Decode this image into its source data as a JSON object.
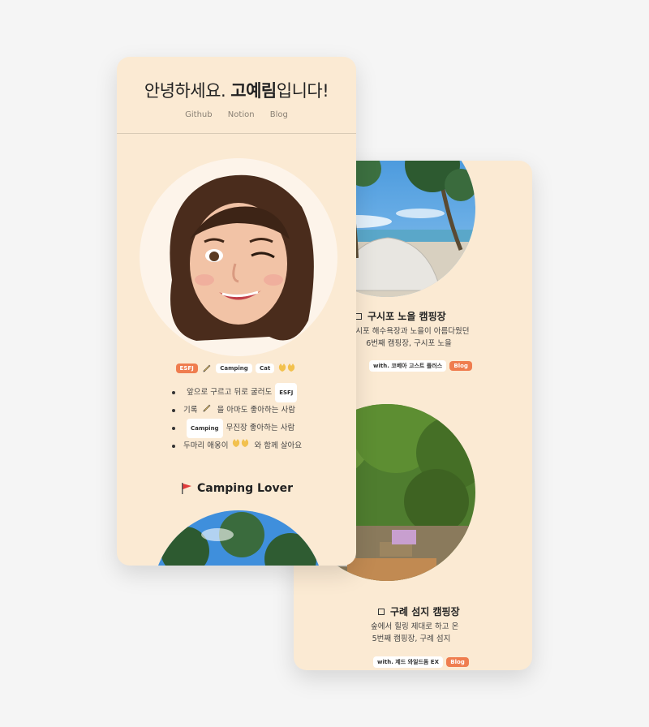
{
  "profile": {
    "greeting_prefix": "안녕하세요. ",
    "name": "고예림",
    "greeting_suffix": "입니다!",
    "nav": [
      "Github",
      "Notion",
      "Blog"
    ],
    "badges": {
      "mbti": "ESFJ",
      "camping": "Camping",
      "cat": "Cat"
    },
    "bio": [
      {
        "text": "앞으로 구르고 뒤로 굴러도",
        "tag": "ESFJ"
      },
      {
        "text_before": "기록",
        "text_after": "을 아마도 좋아하는 사람"
      },
      {
        "tag": "Camping",
        "text": "무진장 좋아하는 사람"
      },
      {
        "text_before": "두마리 애옹이",
        "text_after": "와 함께 살아요"
      }
    ],
    "section_title": "Camping Lover"
  },
  "camps": [
    {
      "title": "구시포 노을 캠핑장",
      "desc_line1": "구시포 해수욕장과 노을이 아름다웠던",
      "desc_line2": "6번째 캠핑장, 구시포 노을",
      "with": "with. 코베아 고스트 플러스",
      "link": "Blog"
    },
    {
      "title": "구례 섬지 캠핑장",
      "desc_line1": "숲에서 힐링 제대로 하고 온",
      "desc_line2": "5번째 캠핑장, 구례 섬지",
      "with": "with. 제드 와일드돔 EX",
      "link": "Blog"
    }
  ],
  "colors": {
    "card_bg": "#fbead3",
    "accent": "#ef7d4f",
    "page_bg": "#f5f5f5"
  },
  "icons": [
    "pencil-icon",
    "cat-faces-icon",
    "red-flag-icon",
    "square-bullet-icon"
  ]
}
